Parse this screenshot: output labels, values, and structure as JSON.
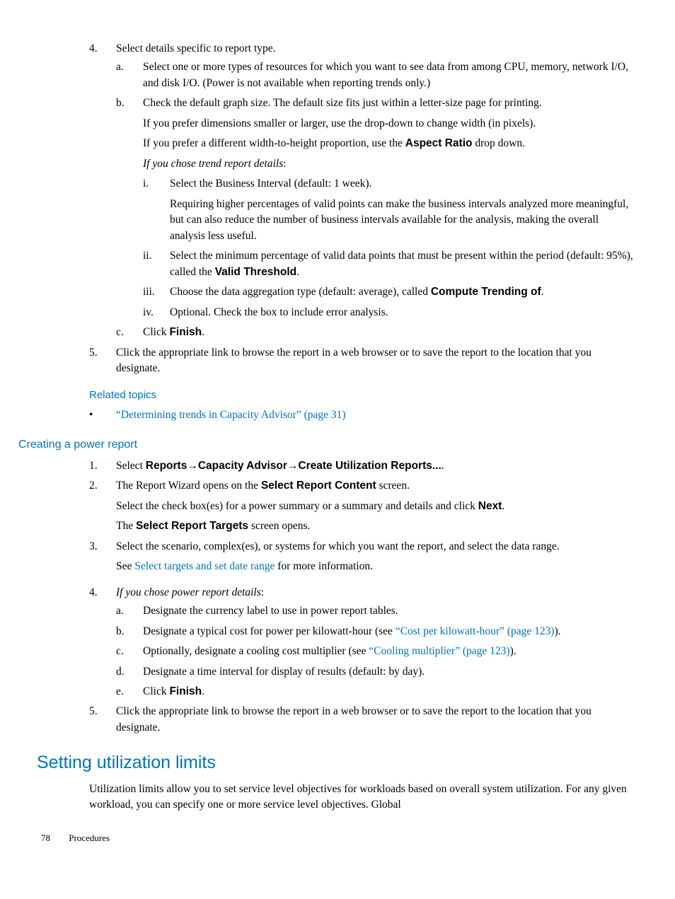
{
  "top": {
    "n4": "4.",
    "t4": "Select details specific to report type.",
    "a": "a.",
    "at": "Select one or more types of resources for which you want to see data from among CPU, memory, network I/O, and disk I/O. (Power is not available when reporting trends only.)",
    "b": "b.",
    "bt": "Check the default graph size. The default size fits just within a letter-size page for printing.",
    "bp1a": "If you prefer dimensions smaller or larger, use the drop-down to change width (in pixels).",
    "bp2a": "If you prefer a different width-to-height proportion, use the ",
    "bp2b": "Aspect Ratio",
    "bp2c": " drop down.",
    "bit": "If you chose trend report details",
    "bitc": ":",
    "ri": "i.",
    "rit": "Select the Business Interval (default: 1 week).",
    "rip": "Requiring higher percentages of valid points can make the business intervals analyzed more meaningful, but can also reduce the number of business intervals available for the analysis, making the overall analysis less useful.",
    "rii": "ii.",
    "riit1": "Select the minimum percentage of valid data points that must be present within the period (default: 95%), called the ",
    "riit2": "Valid Threshold",
    "riit3": ".",
    "riii": "iii.",
    "riiit1": "Choose the data aggregation type (default: average), called ",
    "riiit2": "Compute Trending of",
    "riiit3": ".",
    "riv": "iv.",
    "rivt": "Optional. Check the box to include error analysis.",
    "c": "c.",
    "ct1": "Click ",
    "ct2": "Finish",
    "ct3": ".",
    "n5": "5.",
    "t5": "Click the appropriate link to browse the report in a web browser or to save the report to the location that you designate."
  },
  "related": {
    "heading": "Related topics",
    "link": "“Determining trends in Capacity Advisor” (page 31)"
  },
  "power": {
    "heading": "Creating a power report",
    "n1": "1.",
    "t1a": "Select ",
    "t1b": "Reports",
    "arrow": "→",
    "t1c": "Capacity Advisor",
    "t1d": "Create Utilization Reports...",
    "t1e": ".",
    "n2": "2.",
    "t2a": "The Report Wizard opens on the ",
    "t2b": "Select Report Content",
    "t2c": " screen.",
    "t2p1a": "Select the check box(es) for a power summary or a summary and details and click ",
    "t2p1b": "Next",
    "t2p1c": ".",
    "t2p2a": "The ",
    "t2p2b": "Select Report Targets",
    "t2p2c": " screen opens.",
    "n3": "3.",
    "t3": "Select the scenario, complex(es), or systems for which you want the report, and select the data range.",
    "t3pa": "See ",
    "t3pb": "Select targets and set date range",
    "t3pc": " for more information.",
    "n4": "4.",
    "t4it": "If you chose power report details",
    "t4itc": ":",
    "pa": "a.",
    "pat": "Designate the currency label to use in power report tables.",
    "pb": "b.",
    "pbt1": "Designate a typical cost for power per kilowatt-hour (see ",
    "pbt2": "“Cost per kilowatt-hour” (page 123)",
    "pbt3": ").",
    "pc": "c.",
    "pct1": "Optionally, designate a cooling cost multiplier (see ",
    "pct2": "“Cooling multiplier” (page 123)",
    "pct3": ").",
    "pd": "d.",
    "pdt": "Designate a time interval for display of results (default: by day).",
    "pe": "e.",
    "pet1": "Click ",
    "pet2": "Finish",
    "pet3": ".",
    "n5": "5.",
    "t5": "Click the appropriate link to browse the report in a web browser or to save the report to the location that you designate."
  },
  "limits": {
    "heading": "Setting utilization limits",
    "body": "Utilization limits allow you to set service level objectives for workloads based on overall system utilization. For any given workload, you can specify one or more service level objectives. Global"
  },
  "footer": {
    "page": "78",
    "section": "Procedures"
  }
}
